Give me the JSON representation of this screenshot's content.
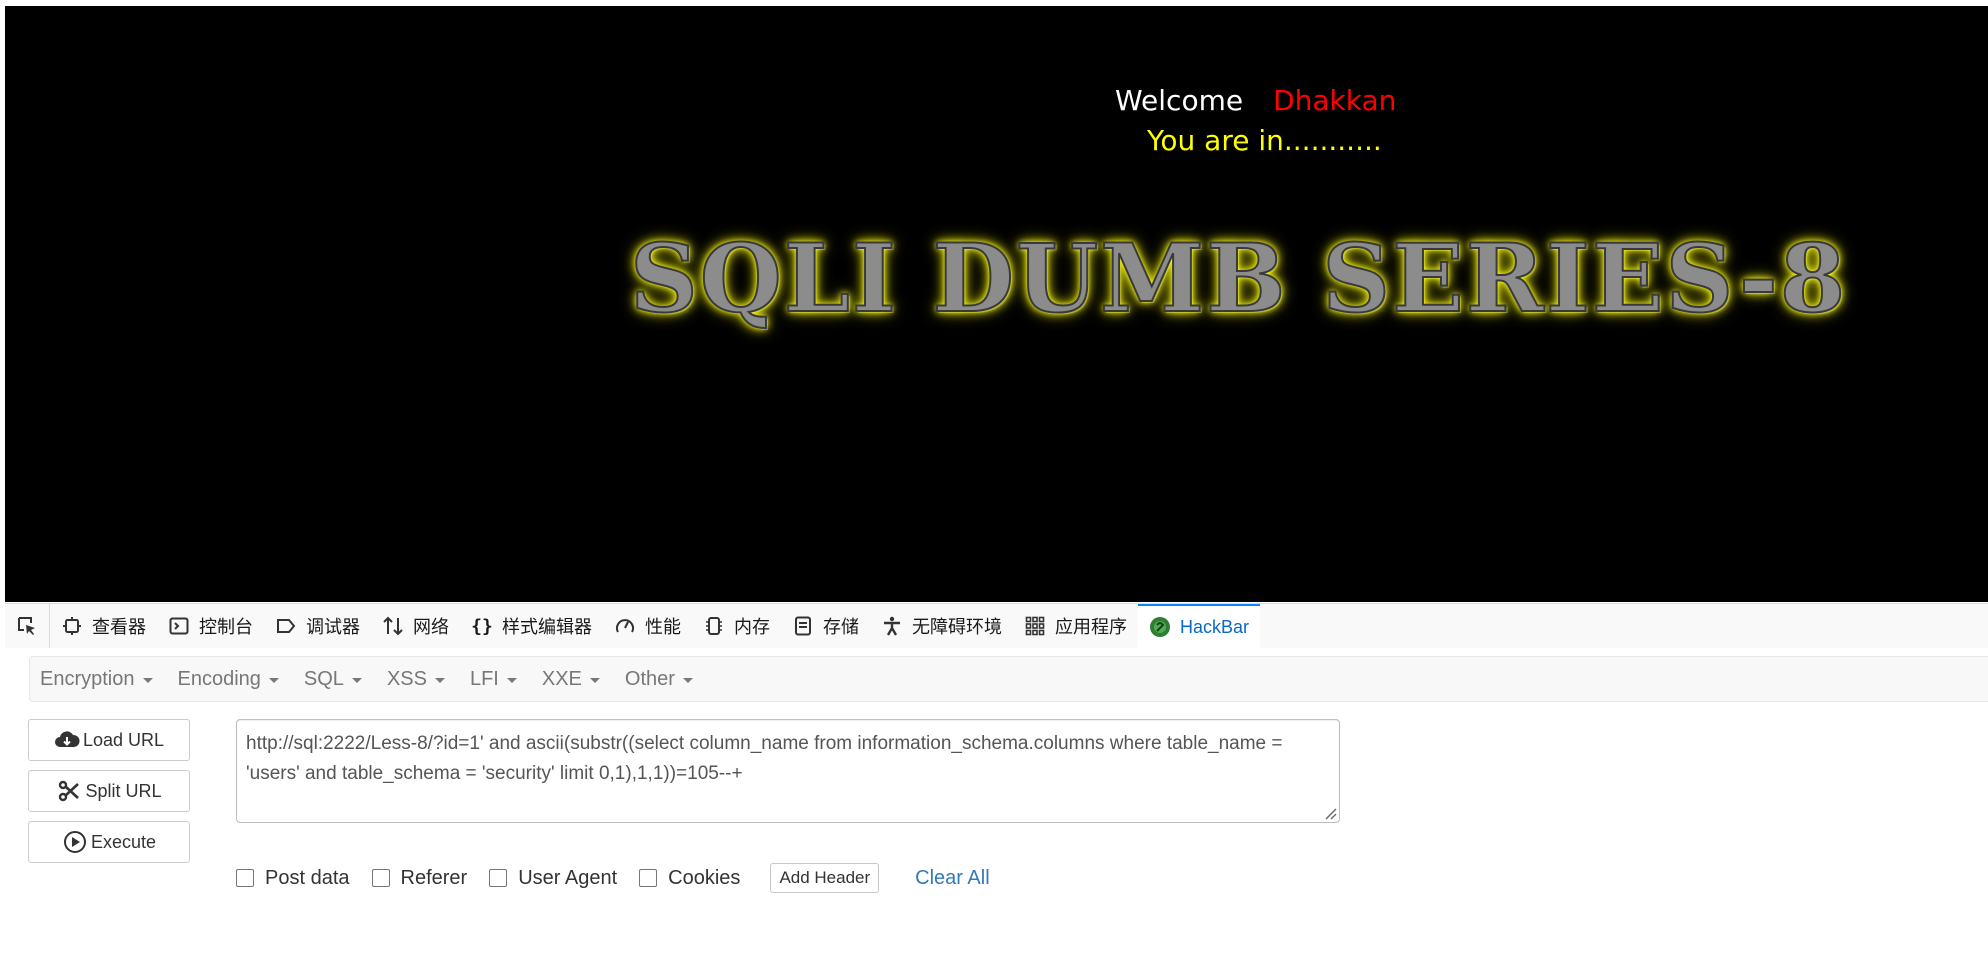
{
  "page": {
    "welcome": "Welcome",
    "user_name": "Dhakkan",
    "status": "You are in...........",
    "banner": "SQLI DUMB SERIES-8"
  },
  "devtools": {
    "tabs": [
      {
        "label": "查看器",
        "icon": "inspector-icon"
      },
      {
        "label": "控制台",
        "icon": "console-icon"
      },
      {
        "label": "调试器",
        "icon": "debugger-icon"
      },
      {
        "label": "网络",
        "icon": "network-icon"
      },
      {
        "label": "样式编辑器",
        "icon": "style-editor-icon"
      },
      {
        "label": "性能",
        "icon": "performance-icon"
      },
      {
        "label": "内存",
        "icon": "memory-icon"
      },
      {
        "label": "存储",
        "icon": "storage-icon"
      },
      {
        "label": "无障碍环境",
        "icon": "accessibility-icon"
      },
      {
        "label": "应用程序",
        "icon": "application-icon"
      },
      {
        "label": "HackBar",
        "icon": "hackbar-icon"
      }
    ],
    "active_tab": "HackBar",
    "accent_color": "#0a84ff"
  },
  "hackbar": {
    "menu": [
      "Encryption",
      "Encoding",
      "SQL",
      "XSS",
      "LFI",
      "XXE",
      "Other"
    ],
    "buttons": {
      "load_url": "Load URL",
      "split_url": "Split URL",
      "execute": "Execute"
    },
    "url": "http://sql:2222/Less-8/?id=1' and ascii(substr((select column_name from information_schema.columns where table_name = 'users' and table_schema = 'security' limit 0,1),1,1))=105--+",
    "options": {
      "post_data": "Post data",
      "referer": "Referer",
      "user_agent": "User Agent",
      "cookies": "Cookies"
    },
    "add_header": "Add Header",
    "clear_all": "Clear All"
  },
  "colors": {
    "welcome": "#ffffff",
    "user_name": "#ff0000",
    "status": "#ffff00",
    "link": "#337ab7"
  }
}
